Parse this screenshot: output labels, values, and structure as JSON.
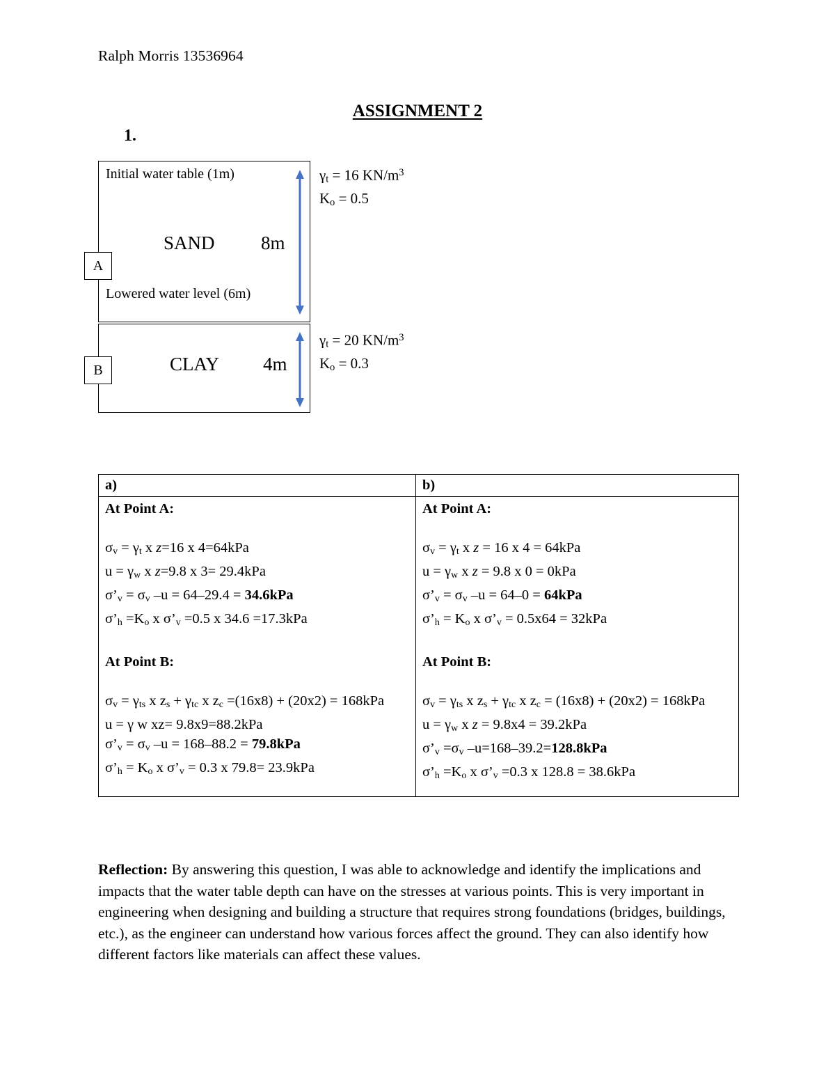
{
  "header": {
    "student": "Ralph Morris 13536964",
    "title": "ASSIGNMENT 2",
    "question_number": "1."
  },
  "diagram": {
    "sand": {
      "name": "SAND",
      "depth": "8m",
      "top_note": "Initial water table (1m)",
      "bottom_note": "Lowered water level (6m)",
      "unit_weight_label": "γ",
      "unit_weight_sub": "t",
      "unit_weight_value": " = 16 KN/m",
      "unit_weight_sup": "3",
      "k0_label": "K",
      "k0_sub": "o",
      "k0_value": " = 0.5"
    },
    "clay": {
      "name": "CLAY",
      "depth": "4m",
      "unit_weight_label": "γ",
      "unit_weight_sub": "t",
      "unit_weight_value": " = 20 KN/m",
      "unit_weight_sup": "3",
      "k0_label": "K",
      "k0_sub": "o",
      "k0_value": " = 0.3"
    },
    "point_a": "A",
    "point_b": "B",
    "arrow_color": "#4472C4"
  },
  "table": {
    "col_a_label": "a)",
    "col_b_label": "b)",
    "point_a_heading": "At Point A:",
    "point_b_heading": "At Point B:",
    "a_point_a": [
      "σv = γt x z=16 x 4=64kPa",
      "u = γw x z=9.8 x 3= 29.4kPa",
      "σ’v = σv –u = 64–29.4 = 34.6kPa",
      "σ’h =Ko x σ’v =0.5 x 34.6 =17.3kPa"
    ],
    "a_point_b": [
      "σv = γts x zs + γtc x zc =(16x8) + (20x2) = 168kPa",
      "u  = γ w xz= 9.8x9=88.2kPa",
      "σ’v = σv –u = 168–88.2 = 79.8kPa",
      "σ’h = Ko x σ’v = 0.3 x 79.8= 23.9kPa"
    ],
    "b_point_a": [
      "σv = γt x z = 16 x 4 = 64kPa",
      "u = γw x z = 9.8 x 0 = 0kPa",
      "σ’v = σv –u = 64–0 = 64kPa",
      "σ’h = Ko x σ’v = 0.5x64 = 32kPa"
    ],
    "b_point_b": [
      "σv = γts x zs + γtc x zc = (16x8) + (20x2) = 168kPa",
      "u = γw x z = 9.8x4 = 39.2kPa",
      "σ’v =σv –u=168–39.2=128.8kPa",
      "σ’h =Ko x σ’v =0.3 x 128.8 = 38.6kPa"
    ]
  },
  "reflection": {
    "lead": "Reflection:",
    "body": " By answering this question, I was able to acknowledge and identify the implications and impacts that the water table depth can have on the stresses at various points. This is very important in engineering when designing and building a structure that requires strong foundations (bridges, buildings, etc.), as the engineer can understand how various forces affect the ground. They can also identify how different factors like materials can affect these values."
  }
}
